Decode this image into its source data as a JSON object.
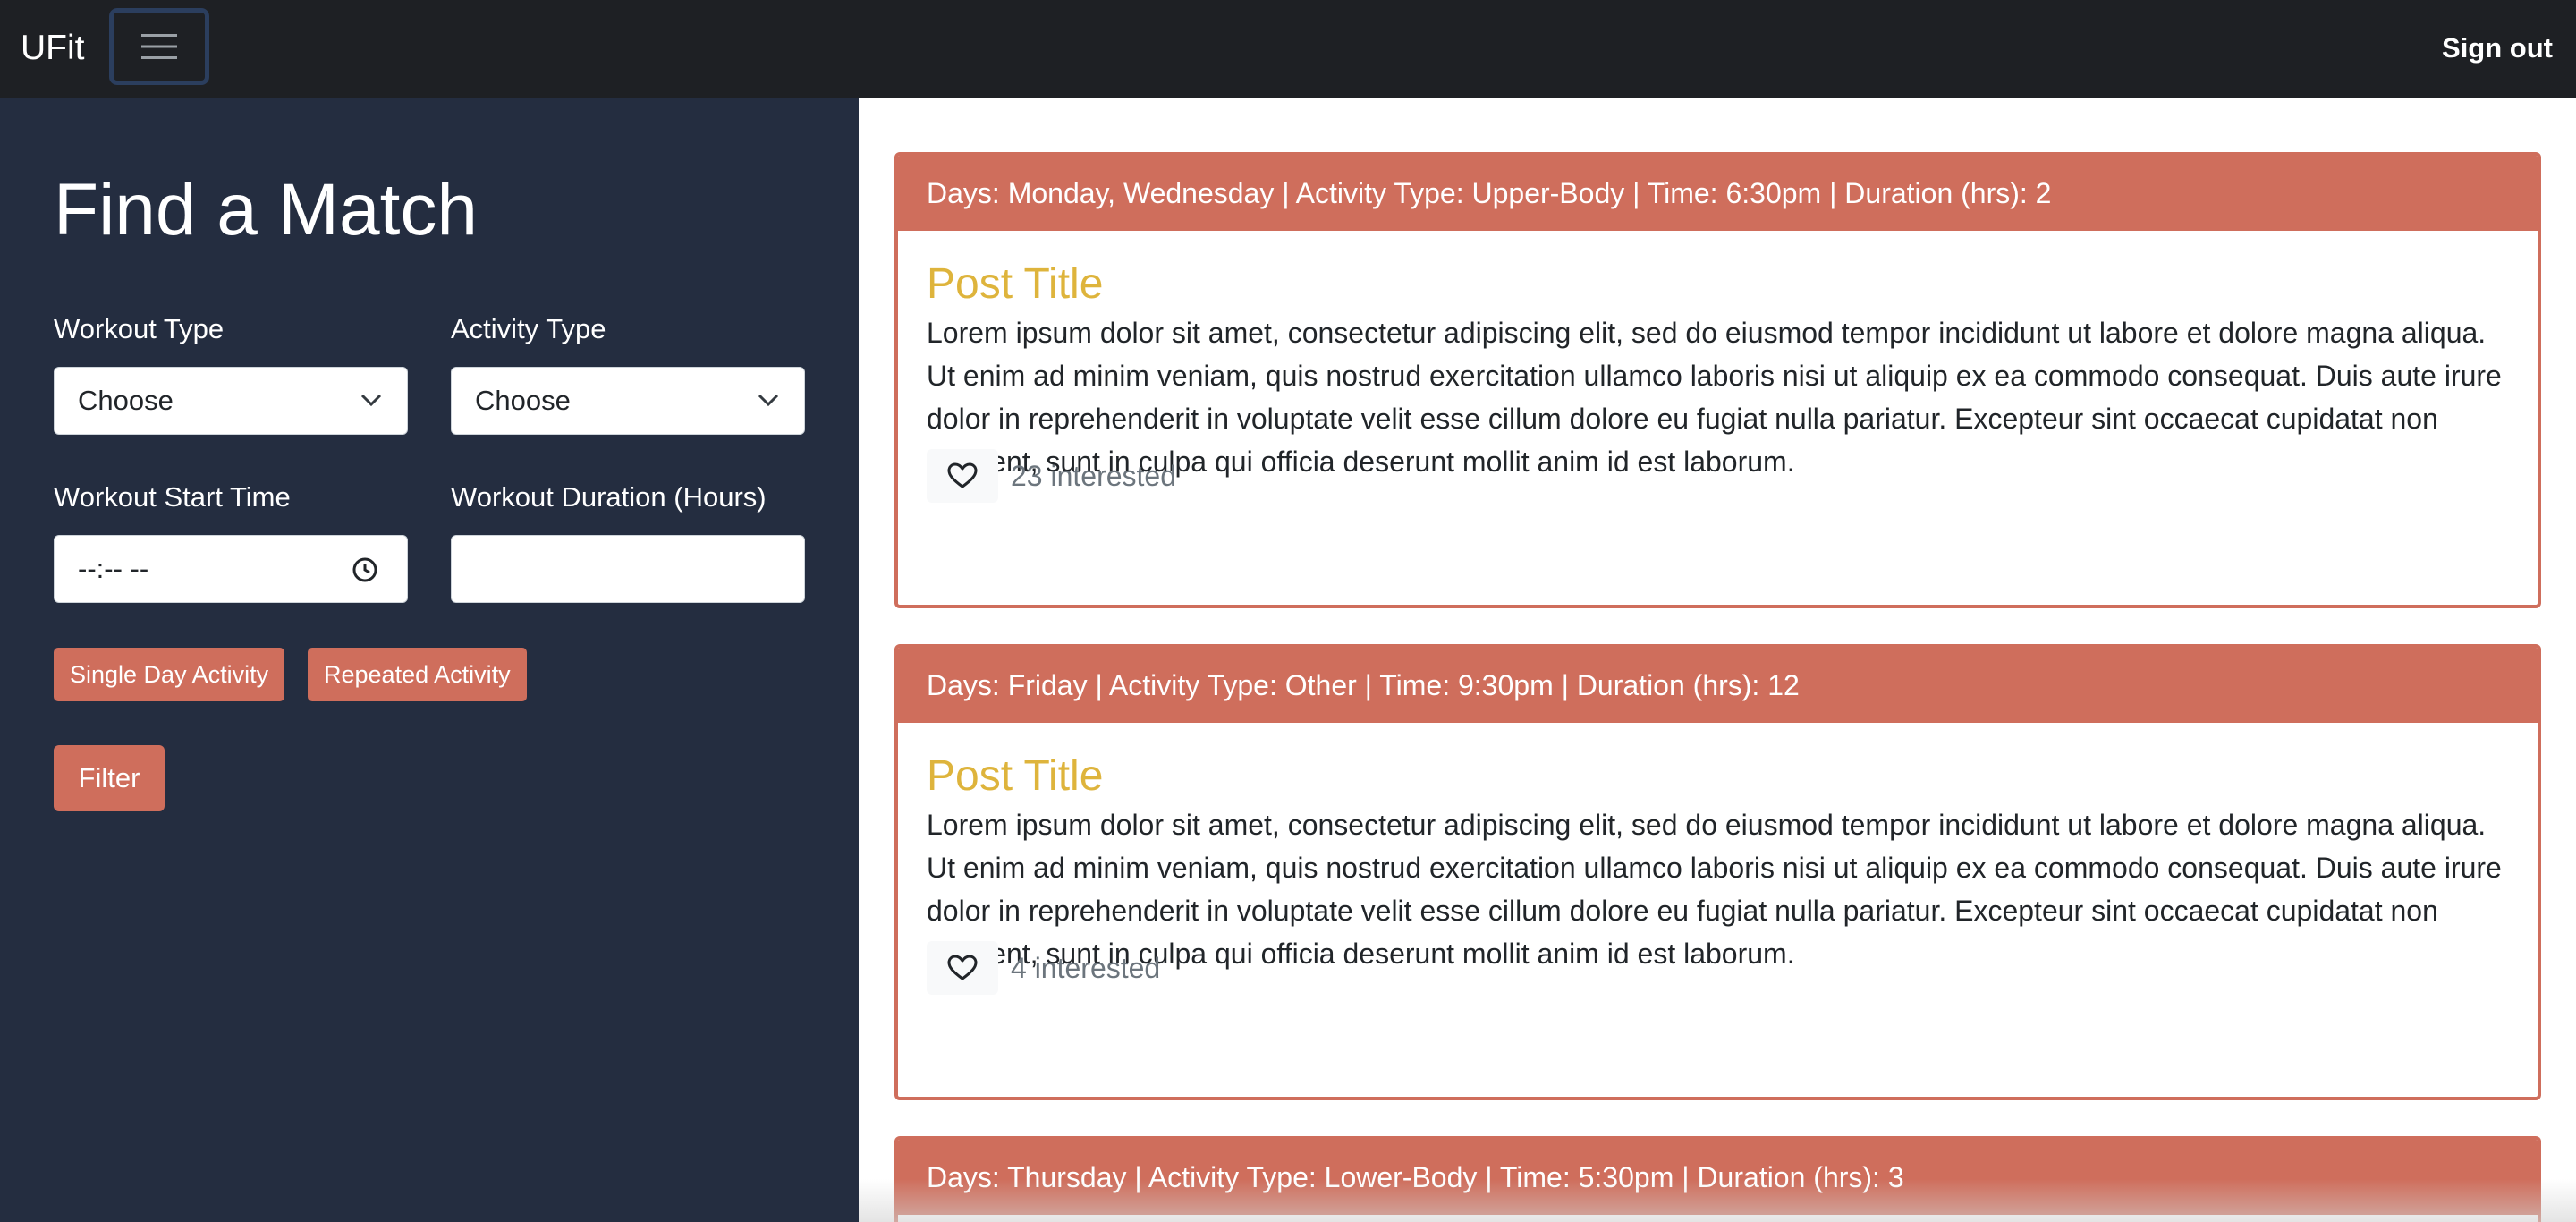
{
  "navbar": {
    "brand": "UFit",
    "menu_icon": "hamburger-menu-icon",
    "signout_label": "Sign out"
  },
  "sidebar": {
    "title": "Find a Match",
    "workout_type": {
      "label": "Workout Type",
      "value": "Choose"
    },
    "activity_type": {
      "label": "Activity Type",
      "value": "Choose"
    },
    "start_time": {
      "label": "Workout Start Time",
      "value": "--:-- --"
    },
    "duration": {
      "label": "Workout Duration (Hours)",
      "value": ""
    },
    "single_day_label": "Single Day Activity",
    "repeated_label": "Repeated Activity",
    "filter_label": "Filter"
  },
  "colors": {
    "accent": "#cf6e5c",
    "title_gold": "#deb43c",
    "sidebar_bg": "#242d40",
    "navbar_bg": "#1e2024"
  },
  "posts": [
    {
      "header": "Days: Monday, Wednesday | Activity Type: Upper-Body | Time: 6:30pm | Duration (hrs): 2",
      "title": "Post Title",
      "body": "Lorem ipsum dolor sit amet, consectetur adipiscing elit, sed do eiusmod tempor incididunt ut labore et dolore magna aliqua. Ut enim ad minim veniam, quis nostrud exercitation ullamco laboris nisi ut aliquip ex ea commodo consequat. Duis aute irure dolor in reprehenderit in voluptate velit esse cillum dolore eu fugiat nulla pariatur. Excepteur sint occaecat cupidatat non proident, sunt in culpa qui officia deserunt mollit anim id est laborum.",
      "interested": "23 interested"
    },
    {
      "header": "Days: Friday | Activity Type: Other | Time: 9:30pm | Duration (hrs): 12",
      "title": "Post Title",
      "body": "Lorem ipsum dolor sit amet, consectetur adipiscing elit, sed do eiusmod tempor incididunt ut labore et dolore magna aliqua. Ut enim ad minim veniam, quis nostrud exercitation ullamco laboris nisi ut aliquip ex ea commodo consequat. Duis aute irure dolor in reprehenderit in voluptate velit esse cillum dolore eu fugiat nulla pariatur. Excepteur sint occaecat cupidatat non proident, sunt in culpa qui officia deserunt mollit anim id est laborum.",
      "interested": "4 interested"
    },
    {
      "header": "Days: Thursday | Activity Type: Lower-Body | Time: 5:30pm | Duration (hrs): 3"
    }
  ]
}
